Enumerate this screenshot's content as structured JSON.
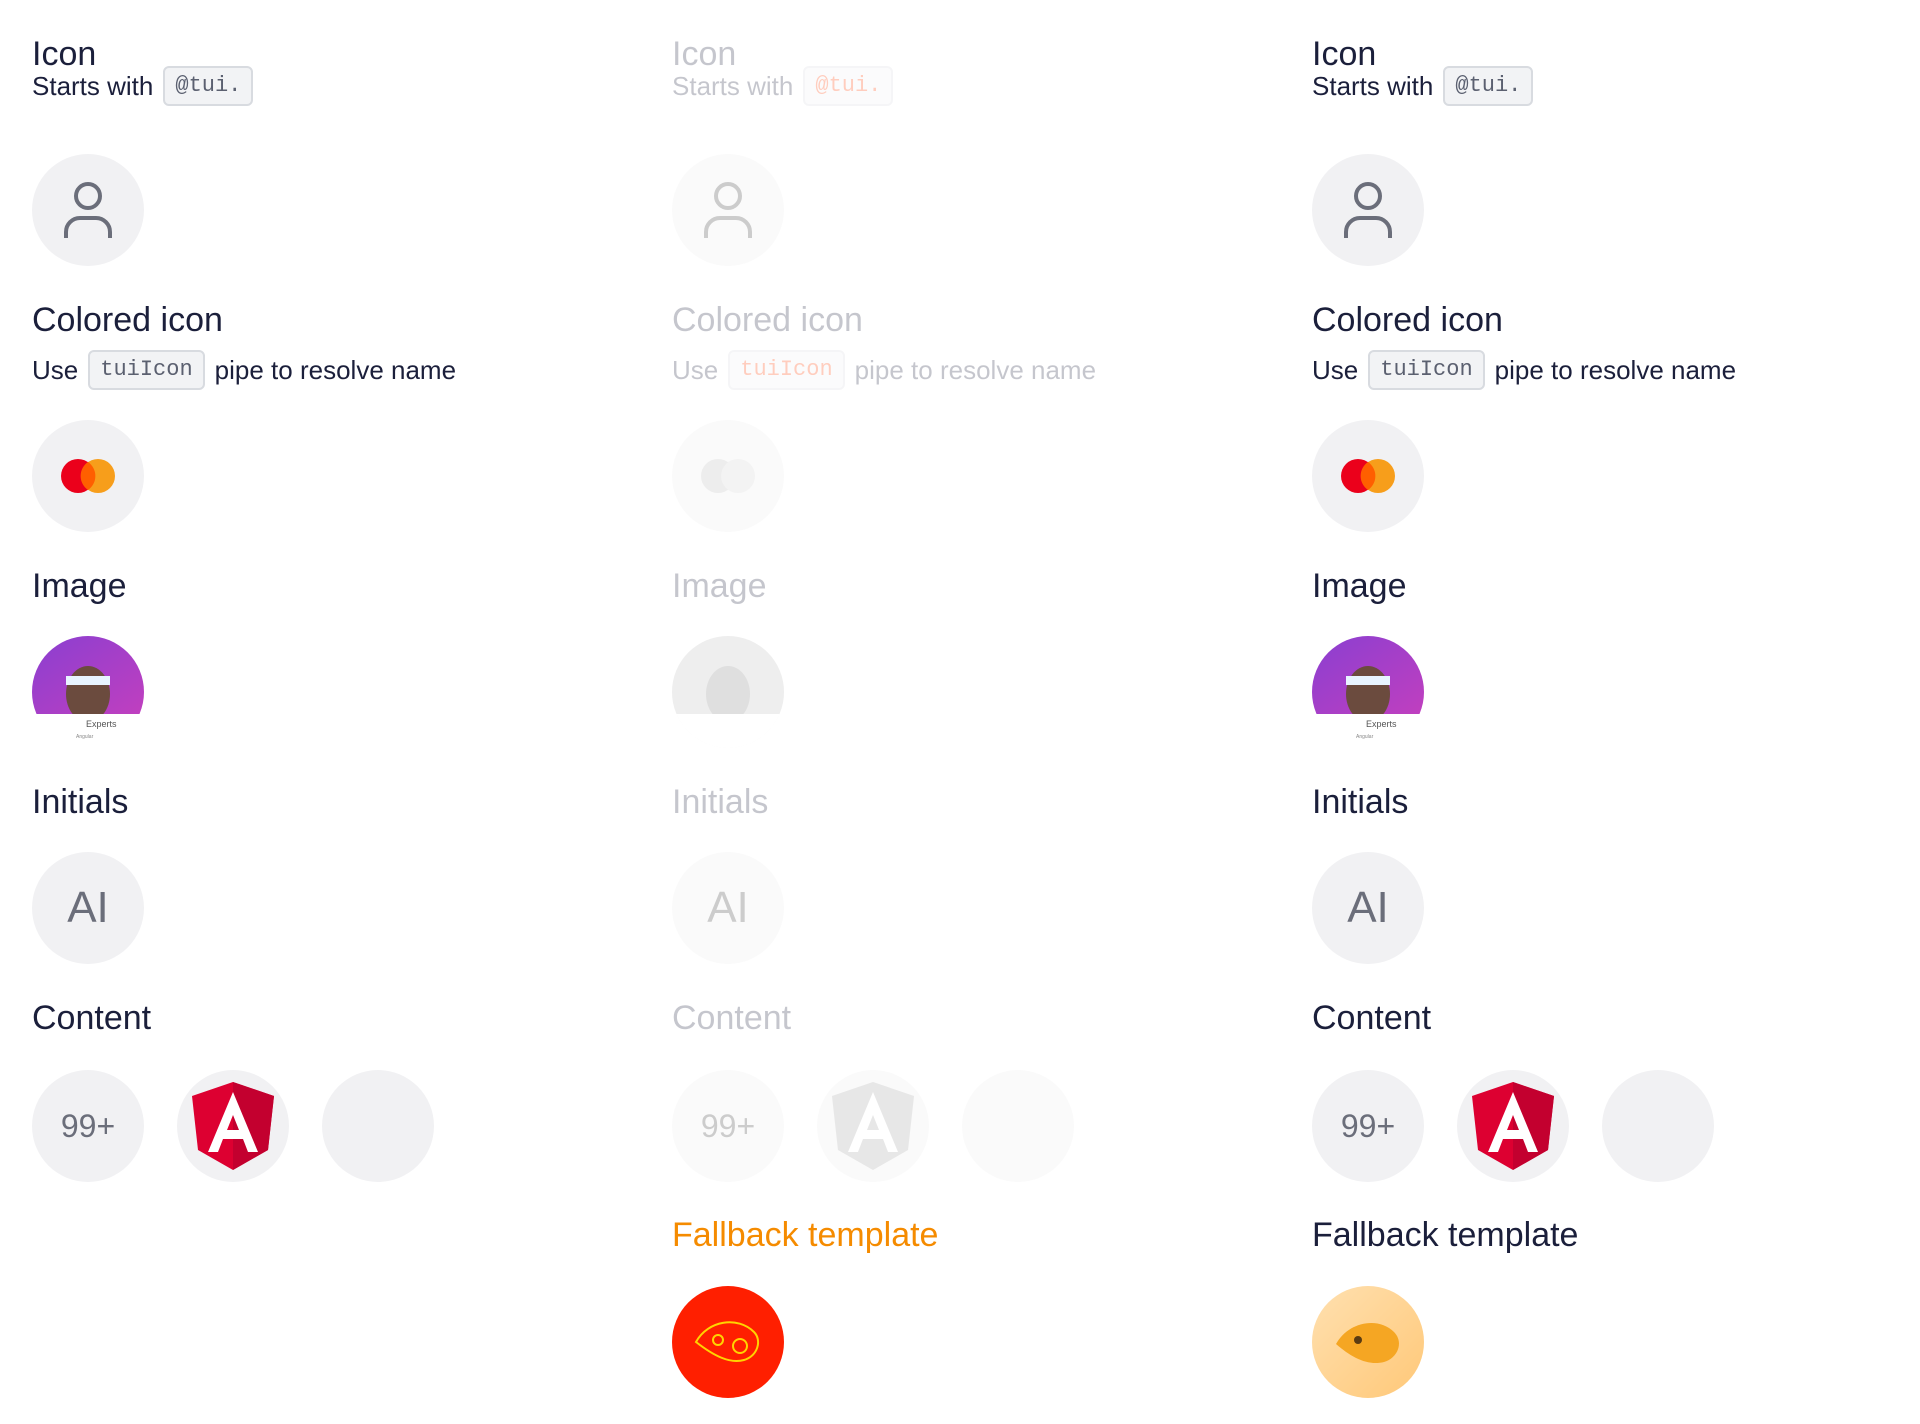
{
  "sections": {
    "icon": {
      "title": "Icon",
      "subtitle_prefix": "Starts with",
      "code": "@tui."
    },
    "colored_icon": {
      "title": "Colored icon",
      "subtitle_prefix": "Use",
      "code": "tuiIcon",
      "subtitle_suffix": "pipe to resolve name"
    },
    "image": {
      "title": "Image",
      "image_caption": "Experts",
      "image_caption_sub": "Angular"
    },
    "initials": {
      "title": "Initials",
      "value": "AI"
    },
    "content": {
      "title": "Content",
      "badge": "99+"
    },
    "fallback": {
      "title": "Fallback template"
    }
  },
  "colors": {
    "text": "#1b1f3b",
    "avatar_bg": "#f1f1f3",
    "mastercard_red": "#eb001b",
    "mastercard_orange": "#f79e1b",
    "angular_red": "#dd0031",
    "fallback_highlight": "#ff1f00"
  },
  "icons": [
    "user-icon",
    "mastercard-icon",
    "angular-logo",
    "fallback-animal-icon"
  ]
}
